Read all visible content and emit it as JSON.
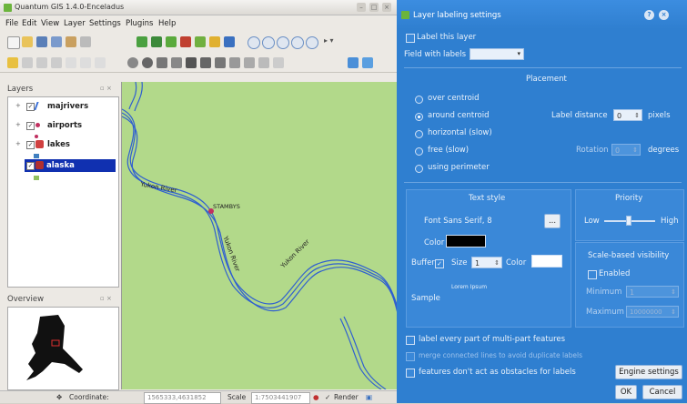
{
  "qgis": {
    "title": "Quantum GIS 1.4.0-Enceladus",
    "menus": [
      "File",
      "Edit",
      "View",
      "Layer",
      "Settings",
      "Plugins",
      "Help"
    ],
    "layers_title": "Layers",
    "layers": [
      {
        "name": "majrivers",
        "checked": true,
        "color": "#3a6fd8"
      },
      {
        "name": "airports",
        "checked": true,
        "color": "#c03060"
      },
      {
        "name": "lakes",
        "checked": true,
        "color": "#4080c0"
      },
      {
        "name": "alaska",
        "checked": true,
        "color": "#b03030",
        "selected": true
      }
    ],
    "overview_title": "Overview",
    "map_labels": {
      "river1": "Yukon River",
      "station": "STAMBYS",
      "river2": "Yukon River",
      "river3": "Yukon River"
    },
    "status": {
      "coordinate_label": "Coordinate:",
      "coordinate_value": "1565333,4631852",
      "scale_label": "Scale",
      "scale_value": "1:7503441907",
      "render_label": "Render"
    },
    "colors": {
      "map_bg": "#b2d98a",
      "river": "#2f5fd0",
      "dialog_bg": "#2f7fd0",
      "selected": "#1030b0"
    }
  },
  "dialog": {
    "title": "Layer labeling settings",
    "label_this_layer": "Label this layer",
    "field_with_labels": "Field with labels",
    "placement_title": "Placement",
    "placement_options": [
      {
        "label": "over centroid",
        "selected": false
      },
      {
        "label": "around centroid",
        "selected": true
      },
      {
        "label": "horizontal (slow)",
        "selected": false
      },
      {
        "label": "free (slow)",
        "selected": false
      },
      {
        "label": "using perimeter",
        "selected": false
      }
    ],
    "label_distance_label": "Label distance",
    "label_distance_value": "0",
    "label_distance_unit": "pixels",
    "rotation_label": "Rotation",
    "rotation_value": "0",
    "rotation_unit": "degrees",
    "text_style_title": "Text style",
    "font_text": "Font Sans Serif, 8",
    "font_button": "...",
    "color_label": "Color",
    "buffer_label": "Buffer",
    "size_label": "Size",
    "size_value": "1",
    "buffer_color_label": "Color",
    "sample_label": "Sample",
    "sample_text": "Lorem Ipsum",
    "priority_title": "Priority",
    "priority_low": "Low",
    "priority_high": "High",
    "scale_visibility_title": "Scale-based visibility",
    "enabled_label": "Enabled",
    "minimum_label": "Minimum",
    "minimum_value": "1",
    "maximum_label": "Maximum",
    "maximum_value": "10000000",
    "multipart_label": "label every part of multi-part features",
    "merge_label": "merge connected lines to avoid duplicate labels",
    "obstacles_label": "features don't act as obstacles for labels",
    "engine_settings": "Engine settings",
    "ok": "OK",
    "cancel": "Cancel"
  }
}
